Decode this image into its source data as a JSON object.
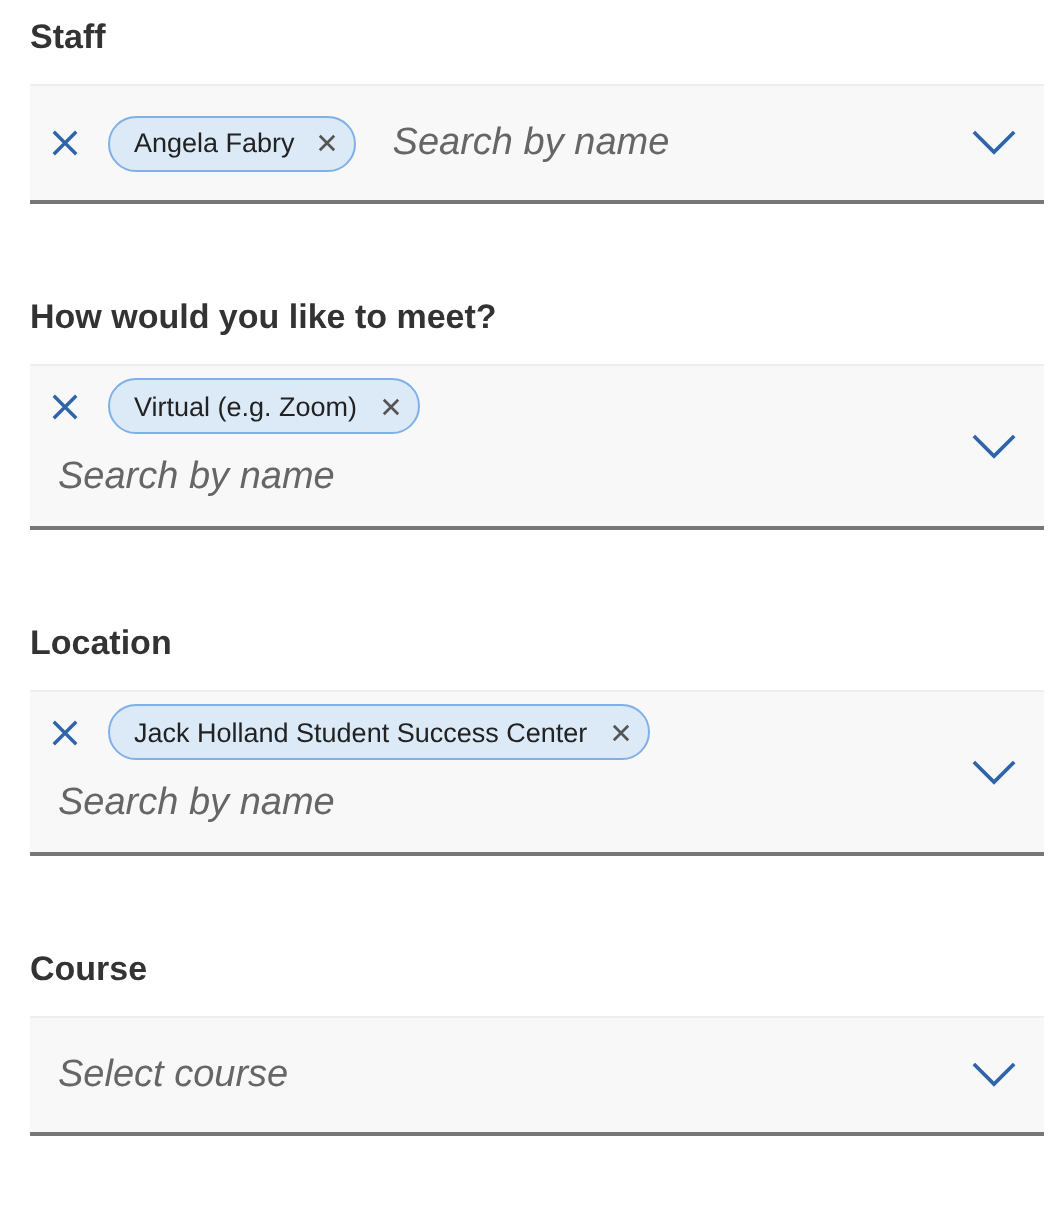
{
  "fields": [
    {
      "label": "Staff",
      "chips": [
        {
          "label": "Angela Fabry"
        }
      ],
      "placeholder": "Search by name"
    },
    {
      "label": "How would you like to meet?",
      "chips": [
        {
          "label": "Virtual (e.g. Zoom)"
        }
      ],
      "placeholder": "Search by name"
    },
    {
      "label": "Location",
      "chips": [
        {
          "label": "Jack Holland Student Success Center"
        }
      ],
      "placeholder": "Search by name"
    },
    {
      "label": "Course",
      "placeholder": "Select course"
    }
  ]
}
